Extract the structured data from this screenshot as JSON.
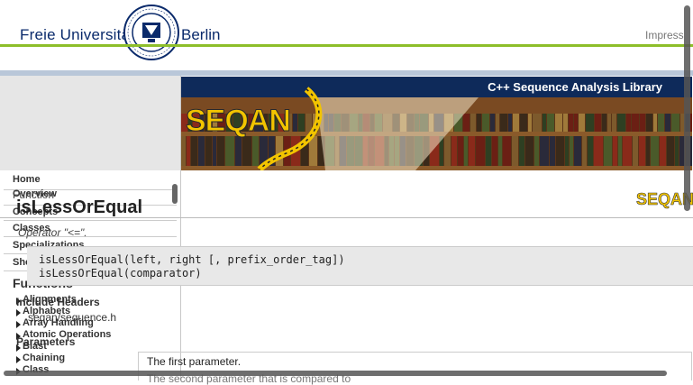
{
  "header": {
    "university_left": "Freie Universität",
    "university_right": "Berlin",
    "impress": "Impress",
    "seal_text": "VERITAS · IUSTITIA · LIBERTAS"
  },
  "banner": {
    "title": "C++ Sequence Analysis Library",
    "logo": "SEQAN",
    "mini_logo": "SEQAN"
  },
  "sidebar": {
    "nav": [
      "Home",
      "Overview",
      "Concepts",
      "Classes",
      "Specializations",
      "Shortcuts"
    ],
    "functions_heading": "Functions",
    "function_groups": [
      "Alignments",
      "Alphabets",
      "Array Handling",
      "Atomic Operations",
      "Blast",
      "Chaining",
      "Class"
    ]
  },
  "main": {
    "section_label": "Function",
    "title": "isLessOrEqual",
    "description": "Operator \"<=\".",
    "signatures": [
      "isLessOrEqual(left, right [, prefix_order_tag])",
      "isLessOrEqual(comparator)"
    ],
    "include_heading": "Include Headers",
    "include_value": "seqan/sequence.h",
    "parameters_heading": "Parameters",
    "param_first": "The first parameter.",
    "param_second": "The second parameter that is compared to"
  },
  "colors": {
    "fu_blue": "#0a2a6b",
    "green_rule": "#8dbe2a",
    "title_bar": "#0e2a5a",
    "seqan_yellow": "#f2c400"
  }
}
